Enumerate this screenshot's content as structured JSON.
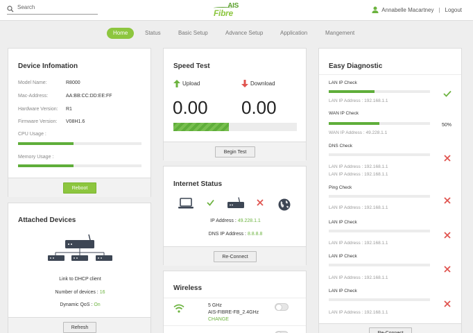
{
  "header": {
    "search_placeholder": "Search",
    "logo_top": "AIS",
    "logo_bottom": "Fibre",
    "user_name": "Annabelle Macartney",
    "separator": "|",
    "logout": "Logout"
  },
  "nav": {
    "home": "Home",
    "status": "Status",
    "basic": "Basic Setup",
    "advance": "Advance Setup",
    "application": "Application",
    "management": "Mangement"
  },
  "device": {
    "title": "Device Infomation",
    "rows": [
      {
        "label": "Model Name:",
        "value": "R8000"
      },
      {
        "label": "Mac-Address:",
        "value": "AA:BB:CC:DD:EE:FF"
      },
      {
        "label": "Hardware Version:",
        "value": "R1"
      },
      {
        "label": "Firmware Version:",
        "value": "V08H1.6"
      }
    ],
    "cpu_label": "CPU Usage :",
    "cpu_usage": 0.45,
    "mem_label": "Memory Usage :",
    "mem_usage": 0.45,
    "reboot": "Reboot"
  },
  "attached": {
    "title": "Attached Devices",
    "link_text": "Link to DHCP client",
    "devices_label": "Number of devices : ",
    "devices_value": "16",
    "qos_label": "Dynamic QoS : ",
    "qos_value": "On",
    "refresh": "Refresh"
  },
  "speed": {
    "title": "Speed Test",
    "upload_label": "Upload",
    "download_label": "Download",
    "upload_value": "0.00",
    "download_value": "0.00",
    "progress": 0.45,
    "begin": "Begin Test"
  },
  "internet": {
    "title": "Internet Status",
    "ip_label": "IP Address : ",
    "ip_value": "49.228.1.1",
    "dns_label": "DNS IP Address : ",
    "dns_value": "8.8.8.8",
    "reconnect": "Re-Connect"
  },
  "wireless": {
    "title": "Wireless",
    "band": "5 GHz",
    "ssid": "AIS-FIBRE-FB_2.4GHz",
    "change": "CHANGE"
  },
  "diagnostic": {
    "title": "Easy Diagnostic",
    "items": [
      {
        "label": "LAN IP Check",
        "progress": 0.45,
        "sub": "LAN IP Address : 192.168.1.1",
        "status": "ok"
      },
      {
        "label": "WAN IP Check",
        "progress": 0.5,
        "percent": "50%",
        "sub": "WAN IP Address : 49.228.1.1",
        "status": "progress"
      },
      {
        "label": "DNS Check",
        "progress": 0,
        "sub": "LAN IP Address : 192.168.1.1",
        "sub2": "LAN IP Address : 192.168.1.1",
        "status": "fail"
      },
      {
        "label": "Ping Check",
        "progress": 0,
        "sub": "LAN IP Address : 192.168.1.1",
        "status": "fail"
      },
      {
        "label": "LAN IP Check",
        "progress": 0,
        "sub": "LAN IP Address : 192.168.1.1",
        "status": "fail"
      },
      {
        "label": "LAN IP Check",
        "progress": 0,
        "sub": "LAN IP Address : 192.168.1.1",
        "status": "fail"
      },
      {
        "label": "LAN IP Check",
        "progress": 0,
        "sub": "LAN IP Address : 192.168.1.1",
        "status": "fail"
      }
    ],
    "reconnect": "Re-Connect"
  },
  "colors": {
    "accent": "#8dc63f",
    "bar": "#5fae3a",
    "fail": "#e0544f"
  }
}
